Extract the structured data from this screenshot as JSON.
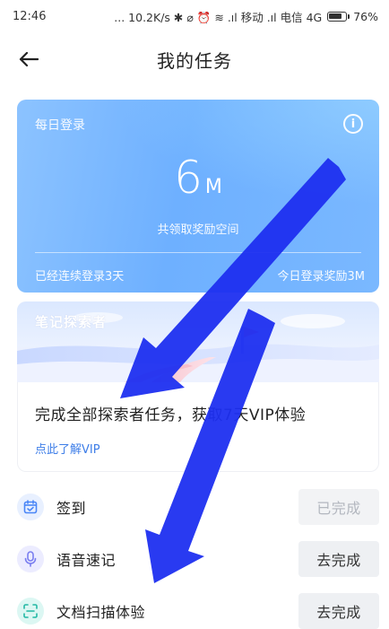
{
  "status_bar": {
    "time": "12:46",
    "info": "... 10.2K/s ✱ ⌀ ⏰ ≋ .ıl 移动 .ıl 电信 4G",
    "battery": "76%"
  },
  "nav": {
    "title": "我的任务"
  },
  "login_card": {
    "label": "每日登录",
    "space_number": "6",
    "space_unit": "M",
    "space_caption": "共领取奖励空间",
    "streak_text": "已经连续登录3天",
    "today_reward": "今日登录奖励3M"
  },
  "explorer_card": {
    "title": "笔记探索者",
    "description": "完成全部探索者任务，获取7天VIP体验",
    "link_text": "点此了解VIP"
  },
  "tasks": [
    {
      "label": "签到",
      "button": "已完成",
      "icon": "calendar-icon",
      "status": "done"
    },
    {
      "label": "语音速记",
      "button": "去完成",
      "icon": "microphone-icon",
      "status": "todo"
    },
    {
      "label": "文档扫描体验",
      "button": "去完成",
      "icon": "scan-icon",
      "status": "todo"
    }
  ],
  "colors": {
    "card_blue": "#7ab8ff",
    "link_blue": "#3e7ee8",
    "arrow_blue": "#1d2ff0"
  }
}
